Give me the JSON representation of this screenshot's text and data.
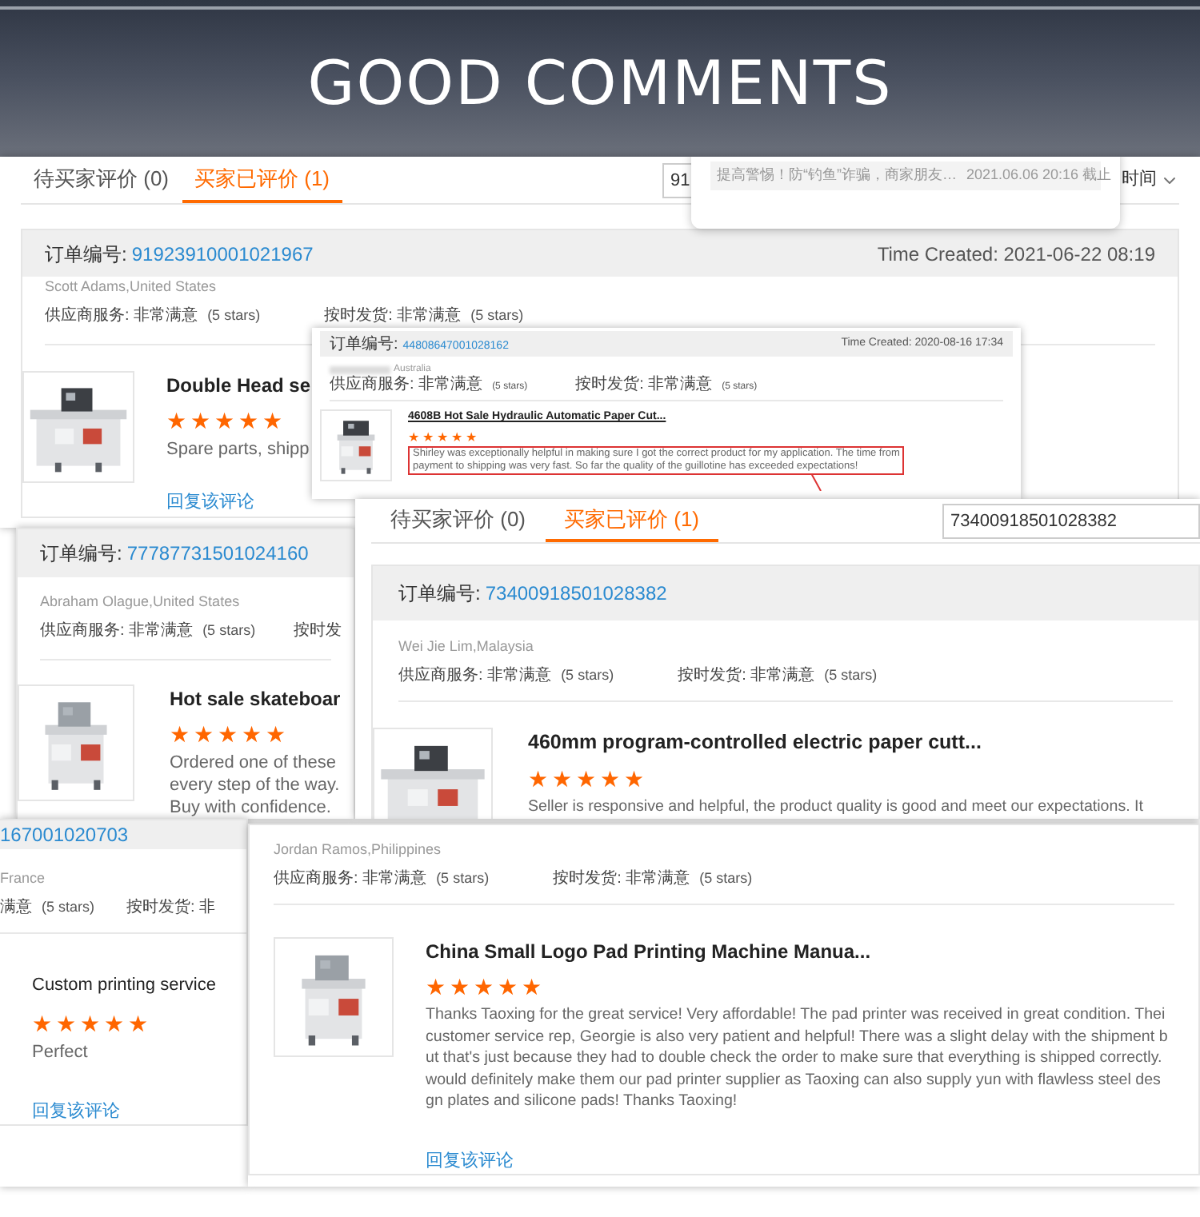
{
  "banner": {
    "title": "GOOD COMMENTS"
  },
  "panels": [
    {
      "tabs": [
        {
          "label": "待买家评价 (0)",
          "selected": false
        },
        {
          "label": "买家已评价 (1)",
          "selected": true
        }
      ],
      "search": {
        "value": "91"
      },
      "notice": {
        "text": "提高警惕！防“钓鱼”诈骗，商家朋友…",
        "time": "2021.06.06 20:16 截止"
      },
      "sort": {
        "label": "时间"
      },
      "order": {
        "label": "订单编号:",
        "number": "91923910001021967",
        "time_created": "Time Created: 2021-06-22 08:19"
      },
      "buyer": "Scott Adams,United States",
      "ratings": [
        {
          "text": "供应商服务: 非常满意",
          "count": "(5 stars)"
        },
        {
          "text": "按时发货: 非常满意",
          "count": "(5 stars)"
        }
      ],
      "product": {
        "image": {
          "kind": "picture"
        },
        "title": "Double Head se",
        "stars": 5,
        "review": [
          "Spare parts, shipp"
        ],
        "reply": "回复该评论"
      }
    },
    {
      "order": {
        "label": "订单编号:",
        "number": "44808647001028162",
        "time_created": "Time Created: 2020-08-16 17:34"
      },
      "buyer": "Australia",
      "name_blurred": true,
      "ratings": [
        {
          "text": "供应商服务: 非常满意",
          "count": "(5 stars)"
        },
        {
          "text": "按时发货: 非常满意",
          "count": "(5 stars)"
        }
      ],
      "product": {
        "image": {
          "kind": "picture"
        },
        "title": "4608B Hot Sale Hydraulic Automatic Paper Cut...",
        "stars": 5,
        "review": [
          "Shirley was exceptionally helpful in making sure I got the correct product for my application. The time from",
          "payment to shipping was very fast. So far the quality of the guillotine has exceeded expectations!"
        ],
        "highlighted": true
      }
    },
    {
      "order": {
        "label": "订单编号:",
        "number": "77787731501024160"
      },
      "buyer": "Abraham Olague,United States",
      "ratings": [
        {
          "text": "供应商服务: 非常满意",
          "count": "(5 stars)"
        },
        {
          "text": "按时发"
        }
      ],
      "product": {
        "image": {
          "kind": "picture"
        },
        "title": "Hot sale skateboar",
        "stars": 5,
        "review": [
          "Ordered one of these",
          "every step of the way.",
          "Buy with confidence."
        ]
      }
    },
    {
      "tabs": [
        {
          "label": "待买家评价 (0)",
          "selected": false
        },
        {
          "label": "买家已评价 (1)",
          "selected": true
        }
      ],
      "search": {
        "value": "73400918501028382"
      },
      "order": {
        "label": "订单编号:",
        "number": "73400918501028382"
      },
      "buyer": "Wei Jie Lim,Malaysia",
      "ratings": [
        {
          "text": "供应商服务: 非常满意",
          "count": "(5 stars)"
        },
        {
          "text": "按时发货: 非常满意",
          "count": "(5 stars)"
        }
      ],
      "product": {
        "image": {
          "kind": "picture"
        },
        "title": "460mm program-controlled electric paper cutt...",
        "stars": 5,
        "review": [
          "Seller is responsive and helpful, the product quality is good and meet our expectations. It"
        ]
      }
    },
    {
      "order": {
        "number": "167001020703"
      },
      "buyer": "France",
      "ratings": [
        {
          "text": "满意",
          "count": "(5 stars)"
        },
        {
          "text": "按时发货: 非"
        }
      ],
      "product": {
        "title": "Custom printing service",
        "stars": 5,
        "review": [
          "Perfect"
        ],
        "reply": "回复该评论"
      }
    },
    {
      "buyer": "Jordan Ramos,Philippines",
      "ratings": [
        {
          "text": "供应商服务: 非常满意",
          "count": "(5 stars)"
        },
        {
          "text": "按时发货: 非常满意",
          "count": "(5 stars)"
        }
      ],
      "product": {
        "image": {
          "kind": "picture"
        },
        "title": "China Small Logo Pad Printing Machine Manua...",
        "stars": 5,
        "review": [
          "Thanks Taoxing for the great service! Very affordable! The pad printer was received in great condition. Thei",
          "customer service rep, Georgie is also very patient and helpful! There was a slight delay with the shipment b",
          "ut that's just because they had to double check the order to make sure that everything is shipped correctly.",
          "would definitely make them our pad printer supplier as Taoxing can also supply yun with flawless steel des",
          "gn plates and silicone pads! Thanks Taoxing!"
        ],
        "reply": "回复该评论"
      }
    }
  ]
}
